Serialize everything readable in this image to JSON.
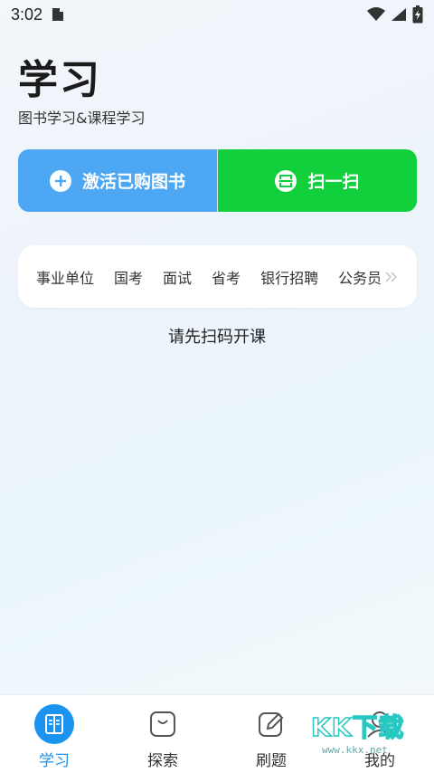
{
  "status_bar": {
    "time": "3:02"
  },
  "header": {
    "title": "学习",
    "subtitle": "图书学习&课程学习"
  },
  "actions": {
    "activate_label": "激活已购图书",
    "scan_label": "扫一扫"
  },
  "categories": [
    "事业单位",
    "国考",
    "面试",
    "省考",
    "银行招聘",
    "公务员"
  ],
  "hint": "请先扫码开课",
  "tab_bar": {
    "tabs": [
      {
        "label": "学习",
        "icon": "book-icon",
        "active": true
      },
      {
        "label": "探索",
        "icon": "bag-icon",
        "active": false
      },
      {
        "label": "刷题",
        "icon": "edit-icon",
        "active": false
      },
      {
        "label": "我的",
        "icon": "user-icon",
        "active": false
      }
    ]
  },
  "watermark": {
    "text": "KK下载",
    "url": "www.kkx.net"
  },
  "colors": {
    "activate": "#4ea7f2",
    "scan": "#12d03c",
    "accent": "#1a94ef"
  }
}
